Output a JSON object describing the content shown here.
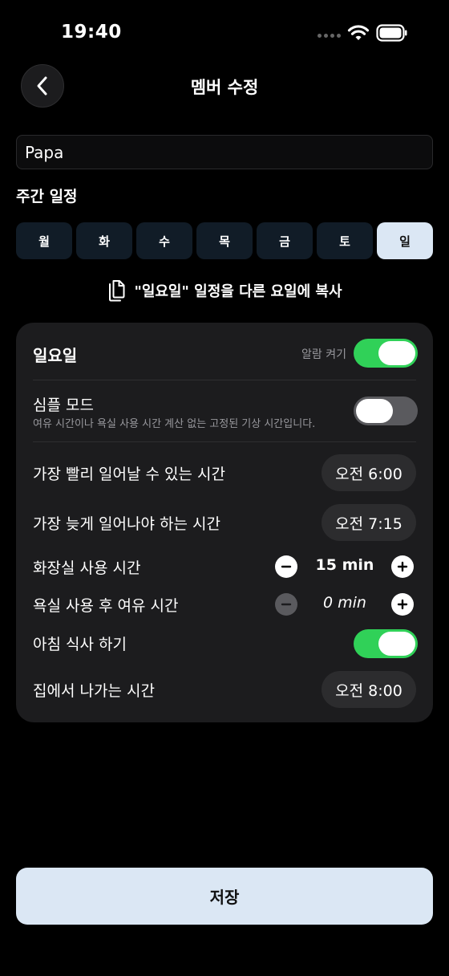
{
  "status_bar": {
    "time": "19:40"
  },
  "header": {
    "title": "멤버 수정",
    "back_icon": "chevron-left-icon"
  },
  "name_field": {
    "value": "Papa"
  },
  "weekly": {
    "title": "주간 일정",
    "days": [
      {
        "label": "월",
        "selected": false
      },
      {
        "label": "화",
        "selected": false
      },
      {
        "label": "수",
        "selected": false
      },
      {
        "label": "목",
        "selected": false
      },
      {
        "label": "금",
        "selected": false
      },
      {
        "label": "토",
        "selected": false
      },
      {
        "label": "일",
        "selected": true
      }
    ],
    "copy_label": "\"일요일\" 일정을 다른 요일에 복사",
    "copy_icon": "copy-icon"
  },
  "card": {
    "day_title": "일요일",
    "alarm_label": "알람 켜기",
    "alarm_on": true,
    "simple_mode": {
      "label": "심플 모드",
      "description": "여유 시간이나 욕실 사용 시간 계산 없는 고정된 기상 시간입니다.",
      "on": false
    },
    "earliest": {
      "label": "가장 빨리 일어날 수 있는 시간",
      "value": "오전 6:00"
    },
    "latest": {
      "label": "가장 늦게 일어나야 하는 시간",
      "value": "오전 7:15"
    },
    "bathroom": {
      "label": "화장실 사용 시간",
      "value": "15 min"
    },
    "buffer": {
      "label": "욕실 사용 후 여유 시간",
      "value": "0 min"
    },
    "breakfast": {
      "label": "아침 식사 하기",
      "on": true
    },
    "leave": {
      "label": "집에서 나가는 시간",
      "value": "오전 8:00"
    }
  },
  "save_button": {
    "label": "저장"
  },
  "colors": {
    "background": "#000000",
    "card": "#1c1c1e",
    "toggle_on": "#30d158",
    "toggle_off": "#5a5a5e",
    "accent_light": "#dbe7f4",
    "day_tab": "#111c27"
  }
}
